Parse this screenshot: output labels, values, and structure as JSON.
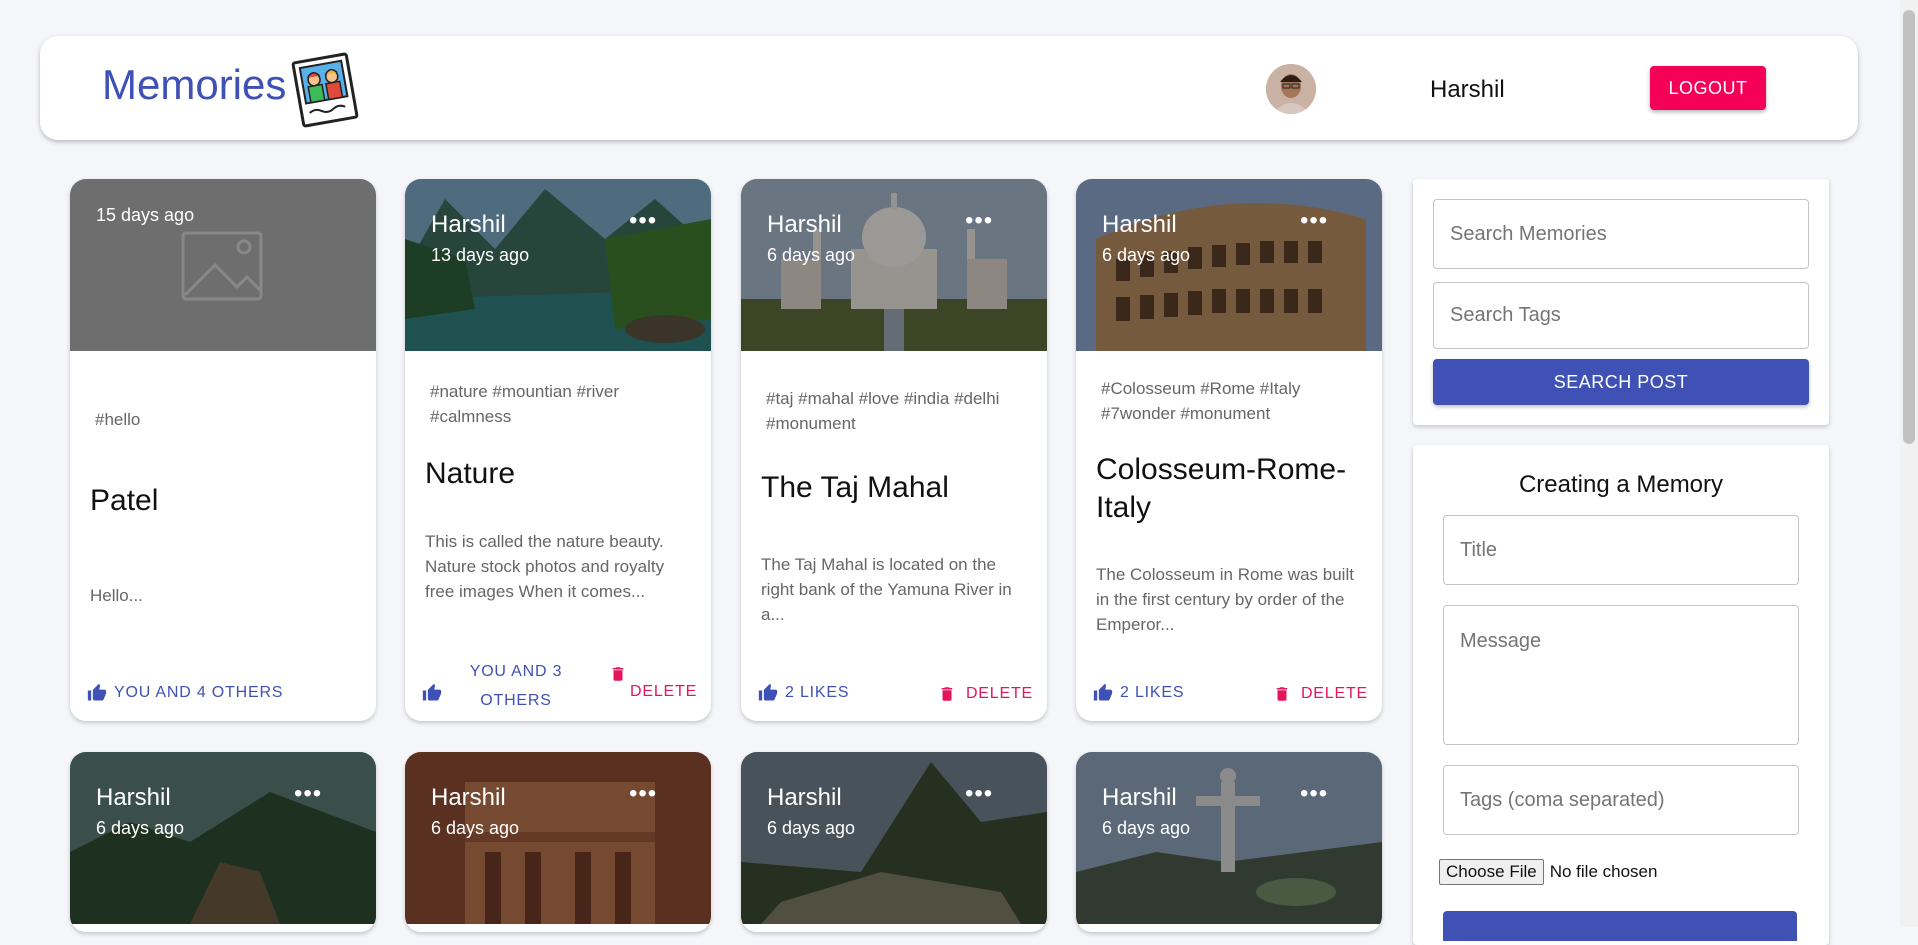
{
  "header": {
    "brand": "Memories",
    "username": "Harshil",
    "logout_label": "LOGOUT"
  },
  "posts_row1": [
    {
      "creator": "",
      "time": "15 days ago",
      "tags": "#hello",
      "title": "Patel",
      "message": "Hello...",
      "likes": "YOU AND 4 OTHERS",
      "delete": ""
    },
    {
      "creator": "Harshil",
      "time": "13 days ago",
      "tags": "#nature #mountian #river #calmness",
      "title": "Nature",
      "message": "This is called the nature beauty. Nature stock photos and royalty free images When it comes...",
      "likes_line1": "YOU AND 3",
      "likes_line2": "OTHERS",
      "delete": "DELETE"
    },
    {
      "creator": "Harshil",
      "time": "6 days ago",
      "tags": "#taj #mahal #love #india #delhi #monument",
      "title": "The Taj Mahal",
      "message": "The Taj Mahal is located on the right bank of the Yamuna River in a...",
      "likes": "2 LIKES",
      "delete": "DELETE"
    },
    {
      "creator": "Harshil",
      "time": "6 days ago",
      "tags": "#Colosseum #Rome #Italy #7wonder #monument",
      "title": "Colosseum-Rome-Italy",
      "message": "The Colosseum in Rome was built in the first century by order of the Emperor...",
      "likes": "2 LIKES",
      "delete": "DELETE"
    }
  ],
  "posts_row2": [
    {
      "creator": "Harshil",
      "time": "6 days ago"
    },
    {
      "creator": "Harshil",
      "time": "6 days ago"
    },
    {
      "creator": "Harshil",
      "time": "6 days ago"
    },
    {
      "creator": "Harshil",
      "time": "6 days ago"
    }
  ],
  "search": {
    "memories_placeholder": "Search Memories",
    "tags_placeholder": "Search Tags",
    "button_label": "SEARCH POST"
  },
  "form": {
    "heading": "Creating a Memory",
    "title_placeholder": "Title",
    "message_placeholder": "Message",
    "tags_placeholder": "Tags (coma separated)",
    "file_button": "Choose File",
    "file_status": "No file chosen"
  },
  "colors": {
    "primary": "#3f51b5",
    "secondary": "#f50057",
    "delete": "#e3165b"
  },
  "icons": [
    "thumb-up-icon",
    "delete-icon",
    "more-horiz-icon",
    "image-placeholder-icon",
    "memories-logo-icon"
  ]
}
